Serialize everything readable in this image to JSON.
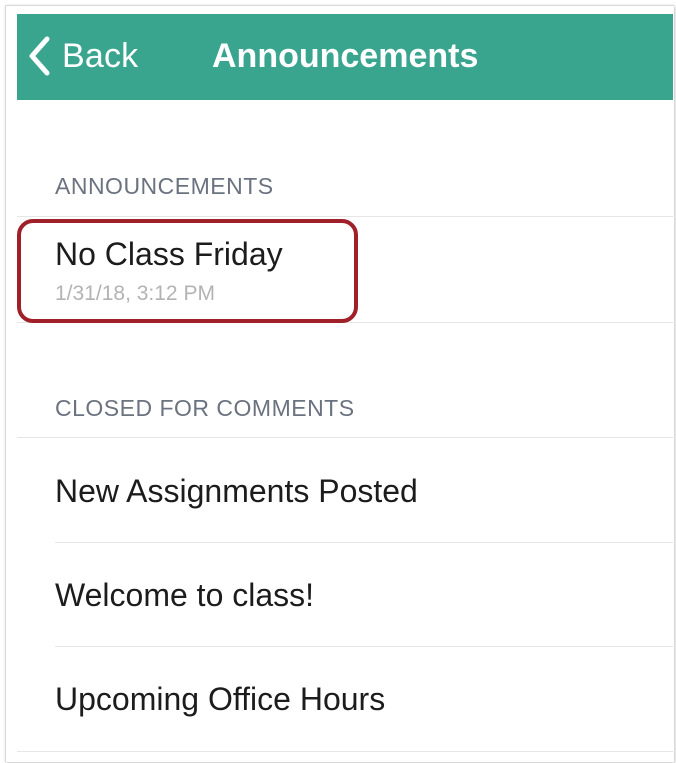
{
  "navbar": {
    "back_label": "Back",
    "title": "Announcements",
    "color": "#3aa58f",
    "back_icon": "chevron-left-icon"
  },
  "sections": [
    {
      "header": "ANNOUNCEMENTS",
      "items": [
        {
          "title": "No Class Friday",
          "date": "1/31/18, 3:12 PM",
          "highlighted": true
        }
      ]
    },
    {
      "header": "CLOSED FOR COMMENTS",
      "items": [
        {
          "title": "New Assignments Posted"
        },
        {
          "title": "Welcome to class!"
        },
        {
          "title": "Upcoming Office Hours"
        }
      ]
    }
  ],
  "colors": {
    "highlight_border": "#a0202a",
    "section_header": "#6b7280",
    "date_text": "#b3b3b3"
  }
}
